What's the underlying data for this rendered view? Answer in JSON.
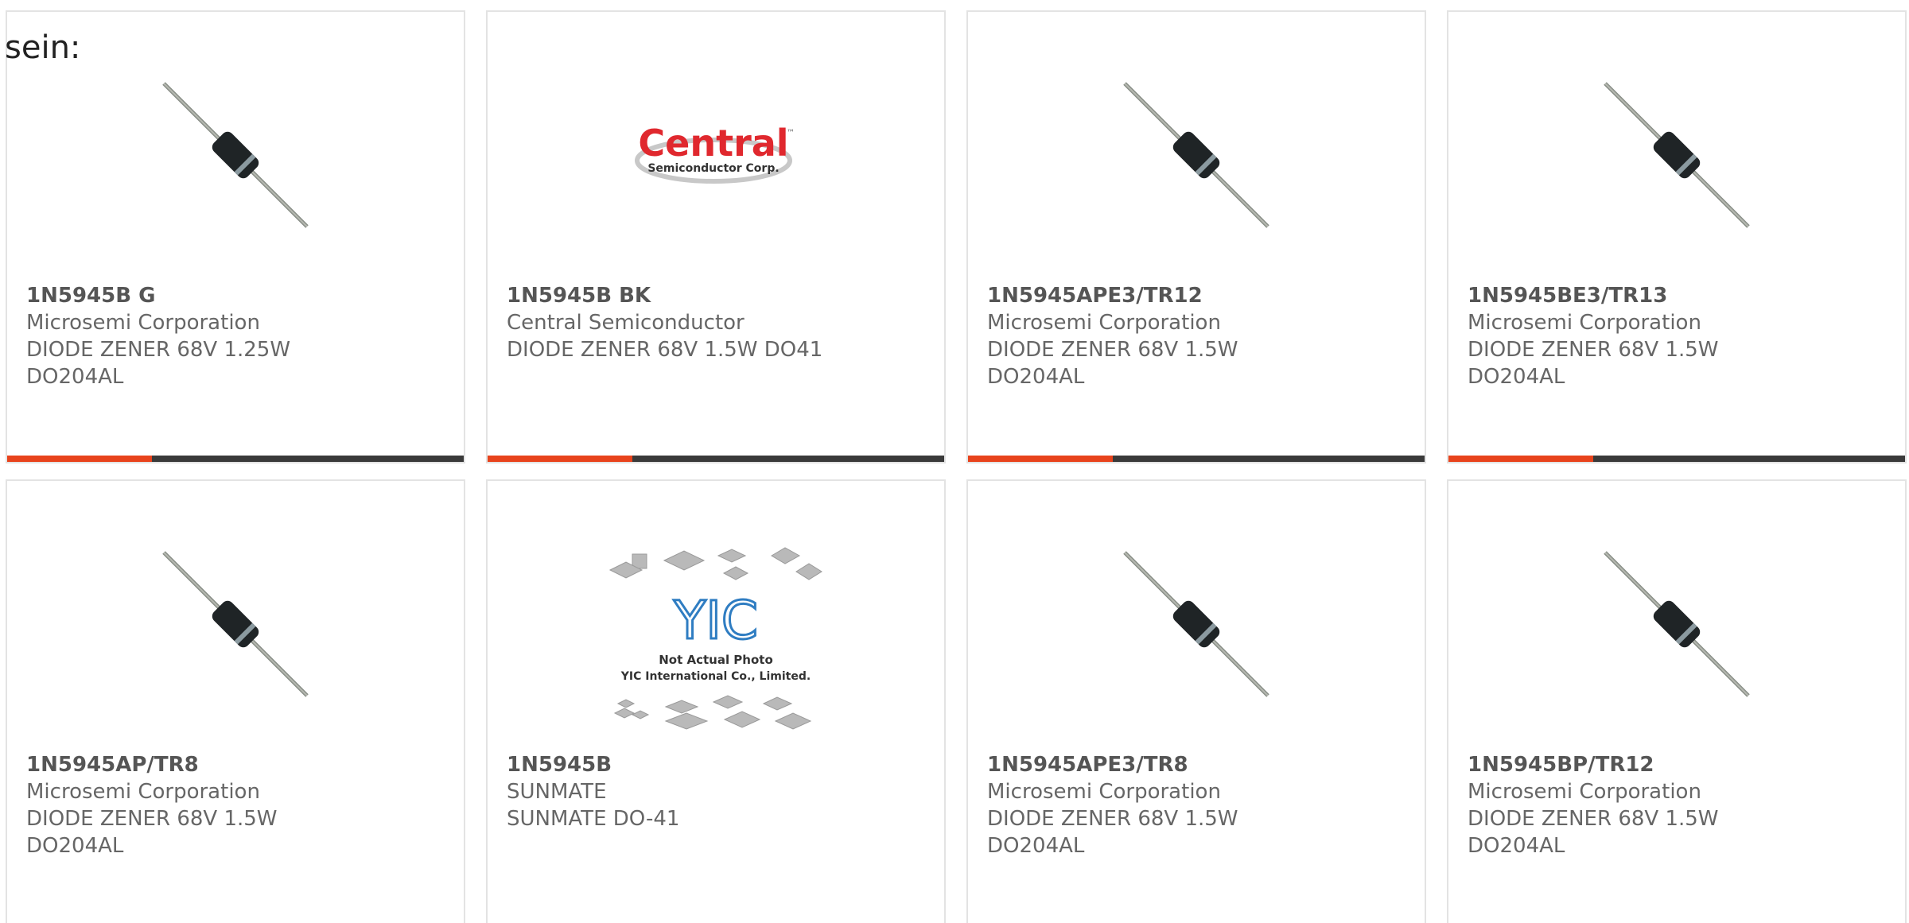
{
  "intro_text": "sein:",
  "colors": {
    "accent": "#e8431c",
    "bar": "#3a3a3a",
    "border": "#e3e3e3",
    "text": "#666666"
  },
  "products": [
    {
      "part": "1N5945B G",
      "maker": "Microsemi Corporation",
      "desc1": "DIODE ZENER 68V 1.25W",
      "desc2": "DO204AL",
      "image": "diode-image"
    },
    {
      "part": "1N5945B BK",
      "maker": "Central Semiconductor",
      "desc1": "DIODE ZENER 68V 1.5W DO41",
      "desc2": "",
      "image": "central-logo"
    },
    {
      "part": "1N5945APE3/TR12",
      "maker": "Microsemi Corporation",
      "desc1": "DIODE ZENER 68V 1.5W",
      "desc2": "DO204AL",
      "image": "diode-image"
    },
    {
      "part": "1N5945BE3/TR13",
      "maker": "Microsemi Corporation",
      "desc1": "DIODE ZENER 68V 1.5W",
      "desc2": "DO204AL",
      "image": "diode-image"
    },
    {
      "part": "1N5945AP/TR8",
      "maker": "Microsemi Corporation",
      "desc1": "DIODE ZENER 68V 1.5W",
      "desc2": "DO204AL",
      "image": "diode-image"
    },
    {
      "part": "1N5945B",
      "maker": "SUNMATE",
      "desc1": "SUNMATE DO-41",
      "desc2": "",
      "image": "yic-placeholder"
    },
    {
      "part": "1N5945APE3/TR8",
      "maker": "Microsemi Corporation",
      "desc1": "DIODE ZENER 68V 1.5W",
      "desc2": "DO204AL",
      "image": "diode-image"
    },
    {
      "part": "1N5945BP/TR12",
      "maker": "Microsemi Corporation",
      "desc1": "DIODE ZENER 68V 1.5W",
      "desc2": "DO204AL",
      "image": "diode-image"
    }
  ],
  "logos": {
    "central_name": "Central",
    "central_sub": "Semiconductor Corp.",
    "central_tm": "™",
    "yic_mark": "YIC",
    "yic_line1": "Not Actual Photo",
    "yic_line2": "YIC International Co., Limited."
  }
}
